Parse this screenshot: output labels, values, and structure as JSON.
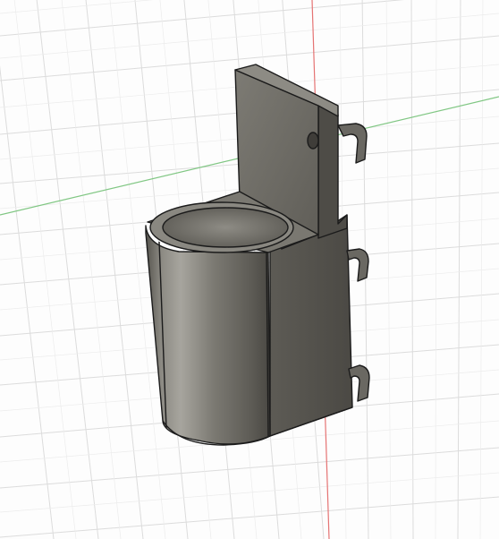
{
  "viewport": {
    "background_color": "#fdfdfd",
    "grid_color": "#d9d9d9",
    "x_axis_color": "#e57373",
    "y_axis_color": "#81c784"
  },
  "model": {
    "body_color": "#6f6d66",
    "highlight_color": "#a19f98",
    "edge_color": "#1b1b1b"
  }
}
